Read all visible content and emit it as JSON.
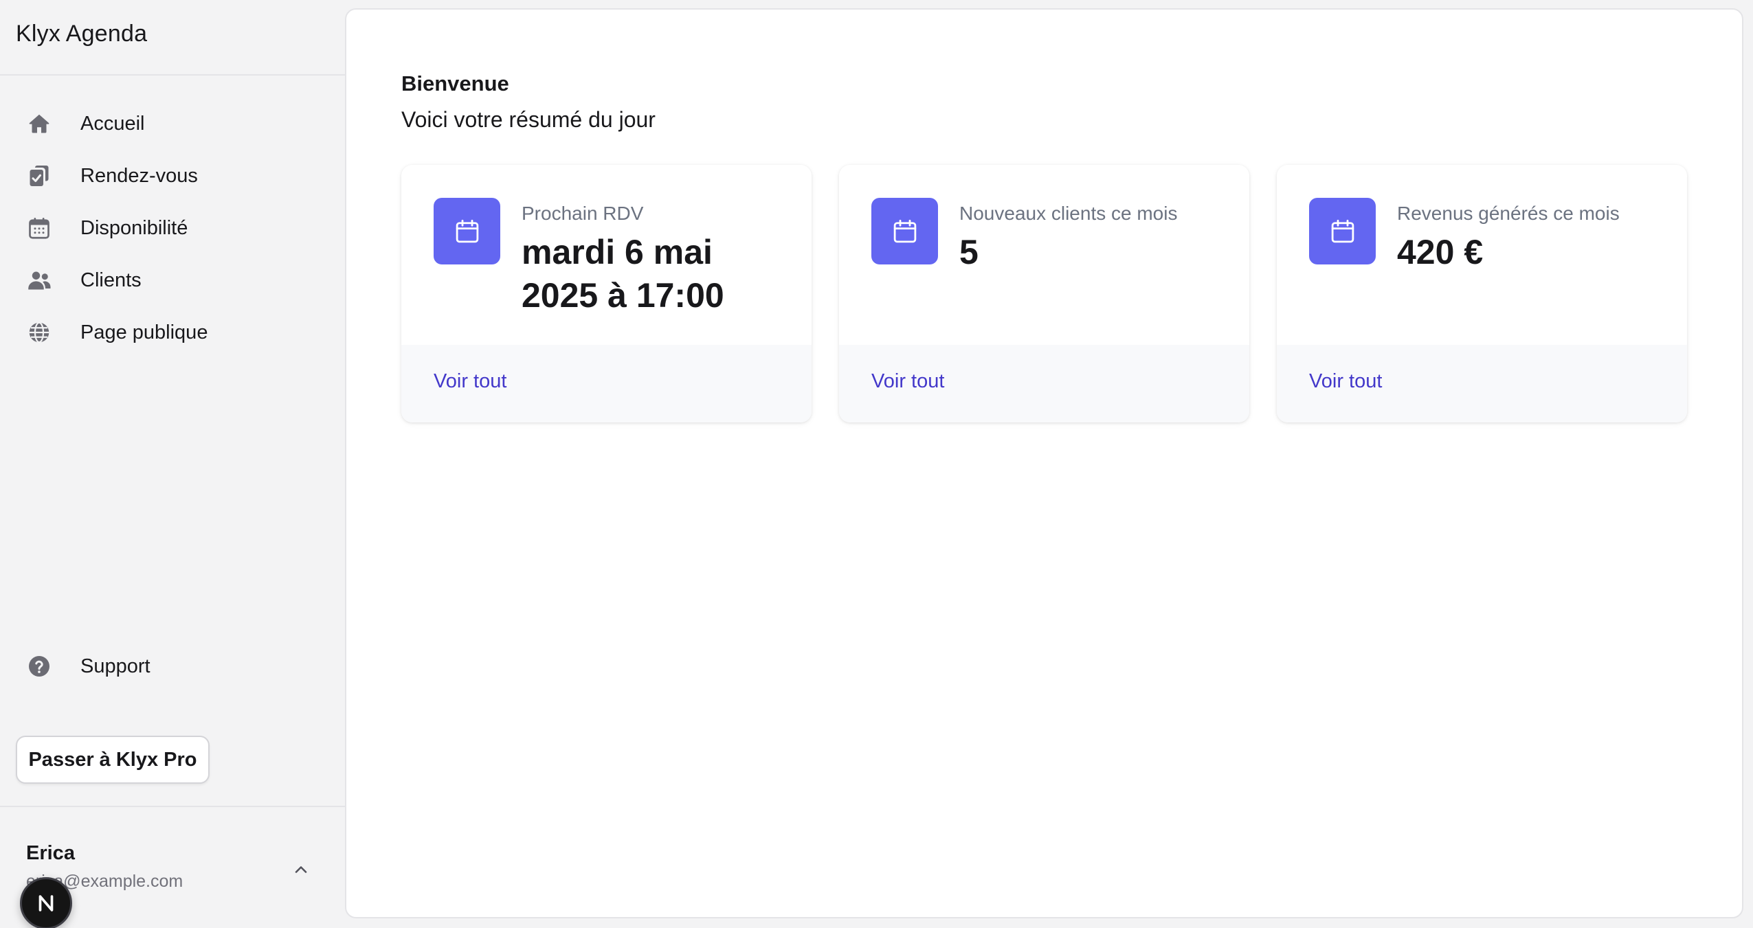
{
  "app": {
    "title": "Klyx Agenda"
  },
  "sidebar": {
    "items": [
      {
        "label": "Accueil",
        "icon": "home-icon"
      },
      {
        "label": "Rendez-vous",
        "icon": "calendar-check-icon"
      },
      {
        "label": "Disponibilité",
        "icon": "calendar-grid-icon"
      },
      {
        "label": "Clients",
        "icon": "users-icon"
      },
      {
        "label": "Page publique",
        "icon": "globe-icon"
      }
    ],
    "support": {
      "label": "Support",
      "icon": "question-icon"
    },
    "upgrade_label": "Passer à Klyx Pro",
    "user": {
      "name": "Erica",
      "email": "erica@example.com",
      "avatar_letter": "N"
    }
  },
  "main": {
    "title": "Bienvenue",
    "subtitle": "Voici votre résumé du jour",
    "cards": [
      {
        "label": "Prochain RDV",
        "value": "mardi 6 mai 2025 à 17:00",
        "link": "Voir tout",
        "icon": "calendar-icon"
      },
      {
        "label": "Nouveaux clients ce mois",
        "value": "5",
        "link": "Voir tout",
        "icon": "calendar-icon"
      },
      {
        "label": "Revenus générés ce mois",
        "value": "420 €",
        "link": "Voir tout",
        "icon": "calendar-icon"
      }
    ]
  },
  "colors": {
    "accent": "#6366f1",
    "link": "#4338ca",
    "sidebar_bg": "#f3f3f4",
    "icon_gray": "#6b6b73"
  }
}
